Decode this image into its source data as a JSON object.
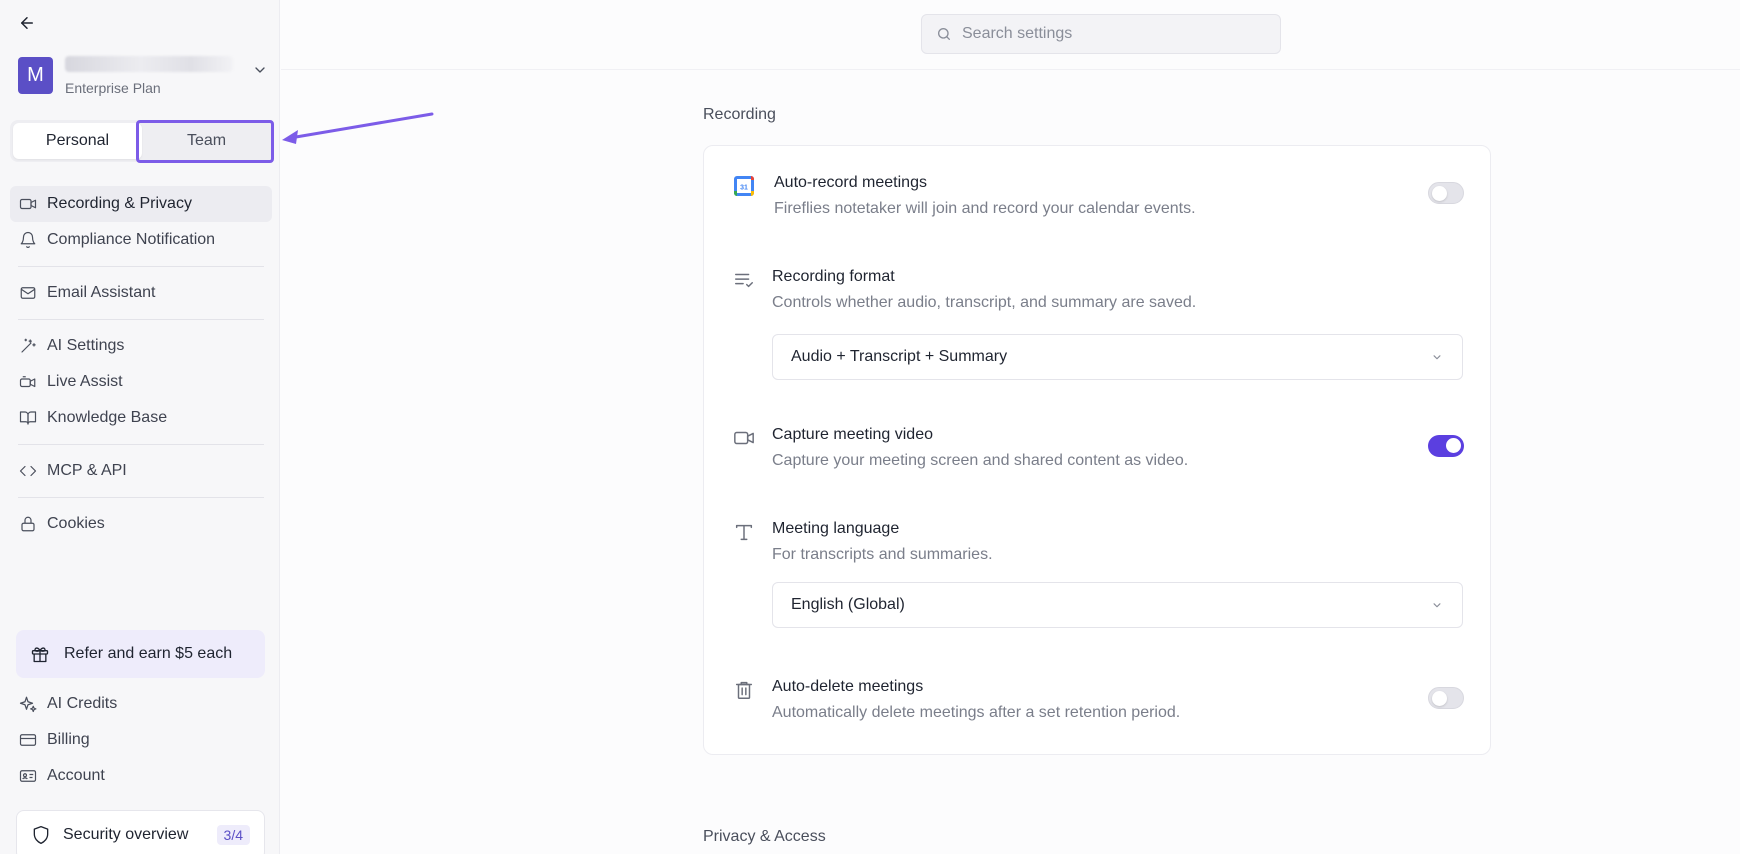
{
  "sidebar": {
    "workspace": {
      "initial": "M",
      "plan": "Enterprise Plan"
    },
    "tabs": [
      {
        "label": "Personal"
      },
      {
        "label": "Team"
      }
    ],
    "nav": {
      "recording_privacy": "Recording & Privacy",
      "compliance": "Compliance Notification",
      "email_assistant": "Email Assistant",
      "ai_settings": "AI Settings",
      "live_assist": "Live Assist",
      "knowledge_base": "Knowledge Base",
      "mcp_api": "MCP & API",
      "cookies": "Cookies"
    },
    "refer": "Refer and earn $5 each",
    "bottom_nav": {
      "ai_credits": "AI Credits",
      "billing": "Billing",
      "account": "Account"
    },
    "security": {
      "label": "Security overview",
      "badge": "3/4"
    }
  },
  "search": {
    "placeholder": "Search settings"
  },
  "main": {
    "recording_section": "Recording",
    "privacy_section": "Privacy & Access",
    "settings": {
      "auto_record": {
        "title": "Auto-record meetings",
        "desc": "Fireflies notetaker will join and record your calendar events.",
        "enabled": false,
        "icon_text": "31"
      },
      "recording_format": {
        "title": "Recording format",
        "desc": "Controls whether audio, transcript, and summary are saved.",
        "value": "Audio + Transcript + Summary"
      },
      "capture_video": {
        "title": "Capture meeting video",
        "desc": "Capture your meeting screen and shared content as video.",
        "enabled": true
      },
      "meeting_language": {
        "title": "Meeting language",
        "desc": "For transcripts and summaries.",
        "value": "English (Global)"
      },
      "auto_delete": {
        "title": "Auto-delete meetings",
        "desc": "Automatically delete meetings after a set retention period.",
        "enabled": false
      }
    }
  },
  "colors": {
    "accent": "#5b3fe0",
    "avatar": "#5b4fc6",
    "highlight": "#7c5ce8"
  }
}
